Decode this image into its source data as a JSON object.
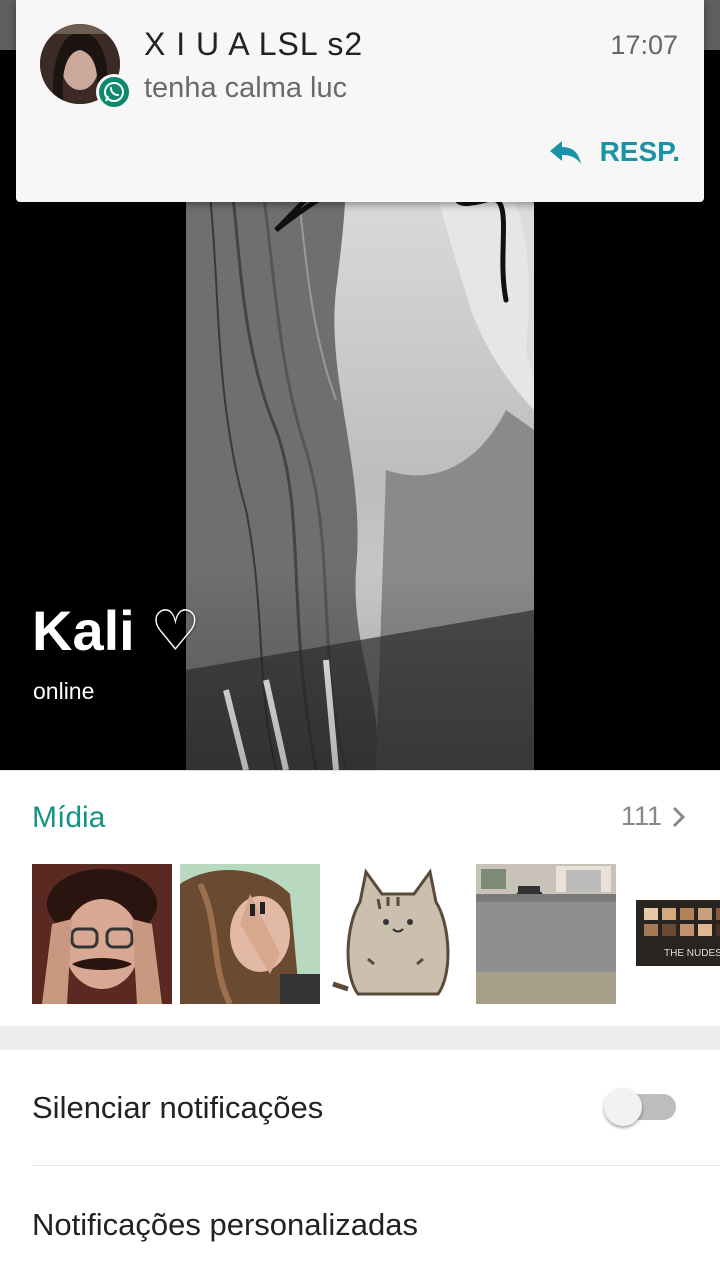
{
  "notification": {
    "sender": "X I U A LSL s2",
    "message": "tenha calma luc",
    "time": "17:07",
    "reply_label": "RESP.",
    "app_icon": "whatsapp-icon",
    "accent_color": "#1a93a6"
  },
  "profile": {
    "name": "Kali ♡",
    "status": "online"
  },
  "media": {
    "title": "Mídia",
    "count": "111",
    "title_color": "#139484",
    "thumbnails": [
      "man-with-mustache-photo",
      "girl-covering-face-photo",
      "pusheen-cat-sticker",
      "street-photo",
      "makeup-palette-photo"
    ],
    "palette_text": "THE NUDES"
  },
  "settings": {
    "mute_label": "Silenciar notificações",
    "mute_enabled": false,
    "custom_notifications_label": "Notificações personalizadas"
  }
}
